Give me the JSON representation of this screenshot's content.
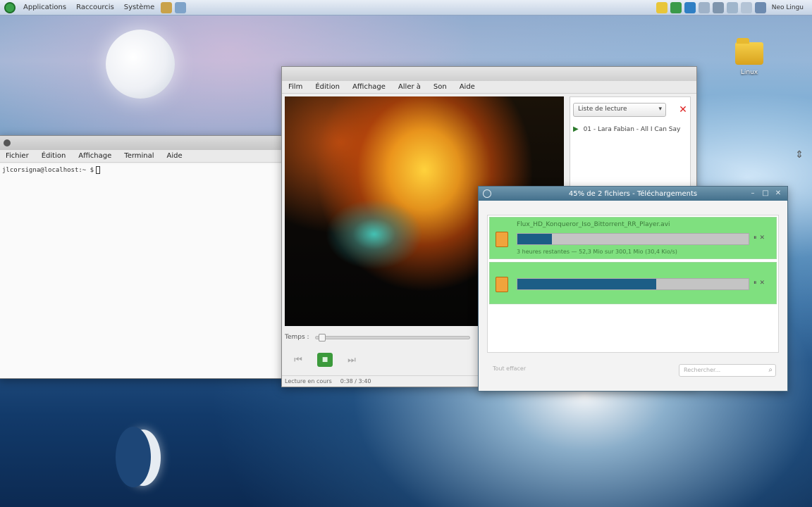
{
  "panel": {
    "menus": [
      "Applications",
      "Raccourcis",
      "Système"
    ],
    "clock": "Neo Lingu"
  },
  "desktop": {
    "folder_label": "Linux"
  },
  "terminal": {
    "title": "",
    "menus": [
      "Fichier",
      "Édition",
      "Affichage",
      "Terminal",
      "Aide"
    ],
    "prompt": "jlcorsigna@localhost:~ $"
  },
  "player": {
    "title": "",
    "menus": [
      "Film",
      "Édition",
      "Affichage",
      "Aller à",
      "Son",
      "Aide"
    ],
    "playlist_selector": "Liste de lecture",
    "playlist_items": [
      "01 - Lara Fabian - All I Can Say"
    ],
    "seek_label": "Temps :",
    "seek_position": 0.02,
    "status_left": "Lecture en cours",
    "status_right": "0:38 / 3:40"
  },
  "downloads": {
    "title": "45% de 2 fichiers - Téléchargements",
    "items": [
      {
        "filename": "Flux_HD_Konqueror_Iso_Bittorrent_RR_Player.avi",
        "progress": 0.15,
        "status": "3 heures restantes — 52,3 Mio sur 300,1 Mio (30,4 Kio/s)"
      },
      {
        "filename": "",
        "progress": 0.6,
        "status": ""
      }
    ],
    "clear_label": "Tout effacer",
    "search_placeholder": "Rechercher..."
  },
  "colors": {
    "download_item_bg": "#7fe07f",
    "progress_fill": "#1c5d86",
    "download_titlebar": "#43708c"
  }
}
